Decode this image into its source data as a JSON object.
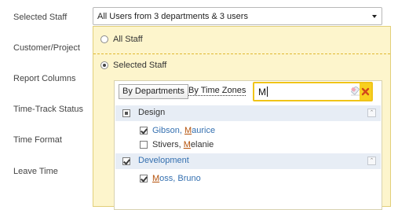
{
  "labels": [
    "Selected Staff",
    "Customer/Project",
    "Report Columns",
    "Time-Track Status",
    "Time Format",
    "Leave Time"
  ],
  "select": {
    "value": "All Users from 3 departments & 3 users"
  },
  "panel": {
    "all_staff": "All Staff",
    "selected_staff": "Selected Staff",
    "by_departments": "By Departments",
    "by_time_zones": "By Time Zones",
    "search_value": "M"
  },
  "groups": [
    {
      "name": "Design",
      "users": [
        {
          "last": "Gibson",
          "first_prefix": "M",
          "first_rest": "aurice",
          "checked": true
        },
        {
          "last": "Stivers",
          "first_prefix": "M",
          "first_rest": "elanie",
          "checked": false
        }
      ]
    },
    {
      "name": "Development",
      "users": [
        {
          "last_prefix": "M",
          "last_rest": "oss",
          "first": "Bruno",
          "checked": true
        }
      ]
    }
  ],
  "colors": {
    "panel_bg": "#fdf5cc",
    "accent": "#f0c418",
    "link": "#3570b0",
    "match": "#b45008"
  }
}
